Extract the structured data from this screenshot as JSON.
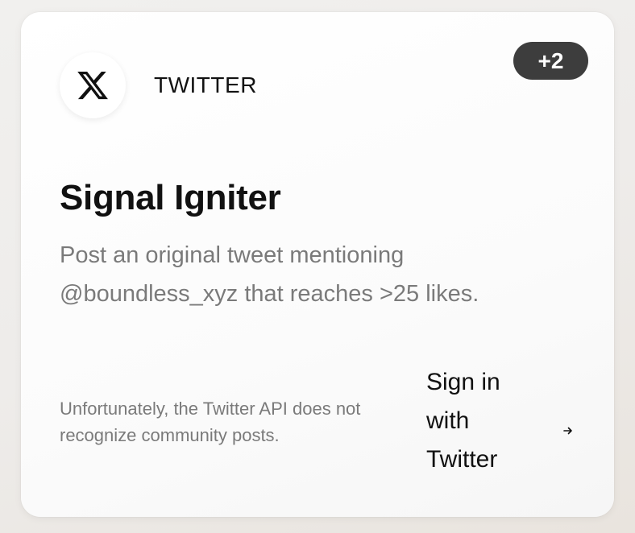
{
  "card": {
    "platform": "TWITTER",
    "badge": "+2",
    "title": "Signal Igniter",
    "description": "Post an original tweet mentioning @boundless_xyz that reaches >25 likes.",
    "note": "Unfortunately, the Twitter API does not recognize community posts.",
    "action_label": "Sign in with Twitter",
    "logo_icon": "x-logo-icon",
    "arrow_icon": "arrow-right-icon"
  }
}
